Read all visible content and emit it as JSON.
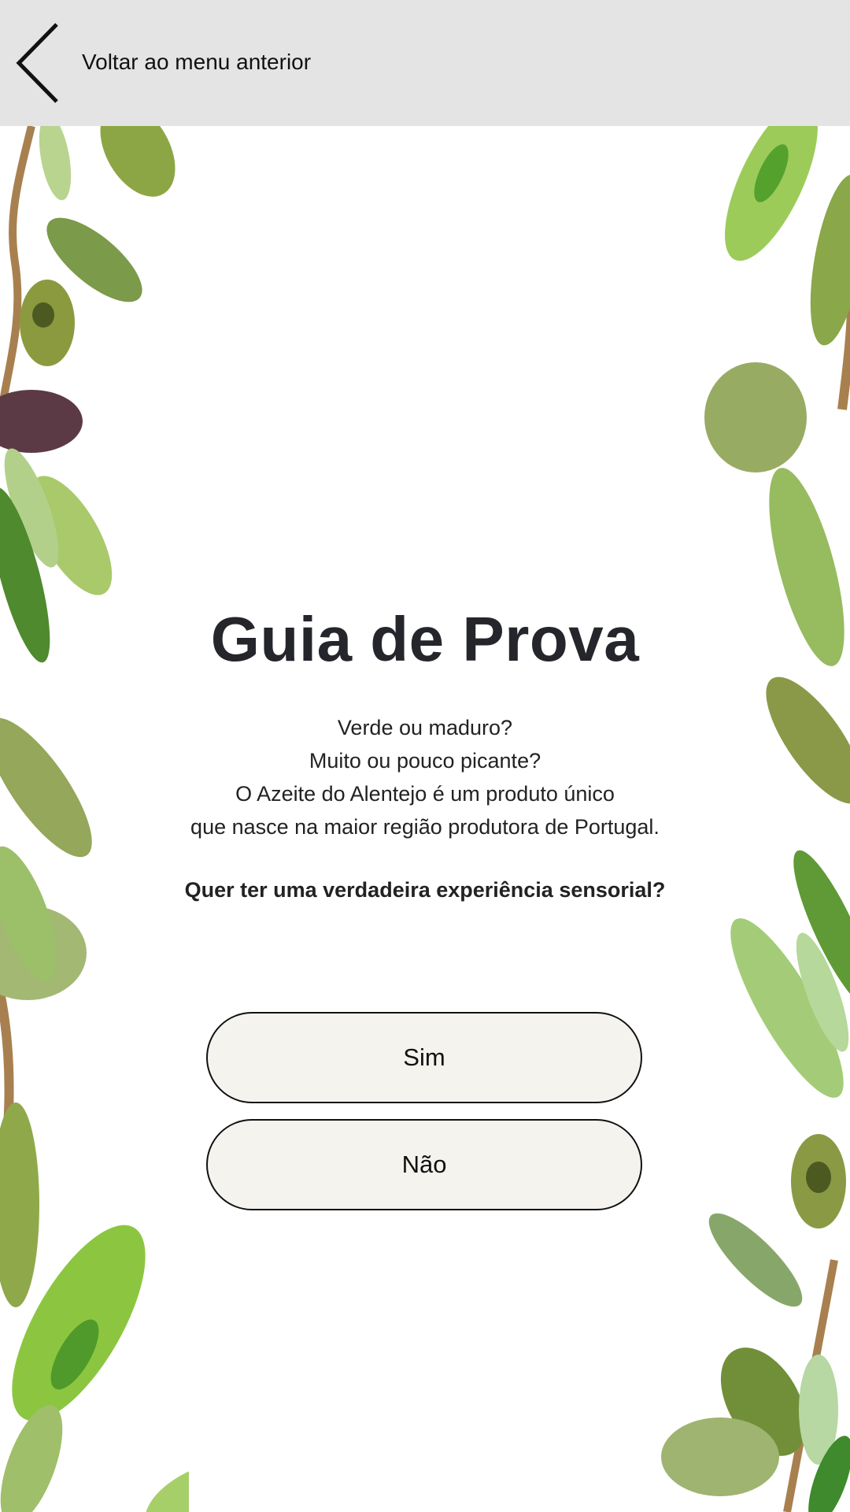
{
  "header": {
    "back_label": "Voltar ao menu anterior",
    "back_icon": "chevron-left-icon",
    "background": "#e4e4e4"
  },
  "main": {
    "title": "Guia de Prova",
    "description_lines": [
      "Verde ou maduro?",
      "Muito ou pouco picante?",
      "O Azeite do Alentejo é um produto único",
      "que nasce na maior região produtora de Portugal."
    ],
    "question": "Quer ter uma verdadeira experiência sensorial?",
    "options": {
      "yes_label": "Sim",
      "no_label": "Não"
    }
  },
  "decoration": {
    "left": "olive-branch-decoration",
    "right": "olive-branch-decoration"
  },
  "colors": {
    "title": "#24262b",
    "button_fill": "#f4f3ee",
    "leaf_light": "#a9c96b",
    "leaf_dark": "#6f8f3a",
    "olive_dark": "#5c3a45"
  }
}
